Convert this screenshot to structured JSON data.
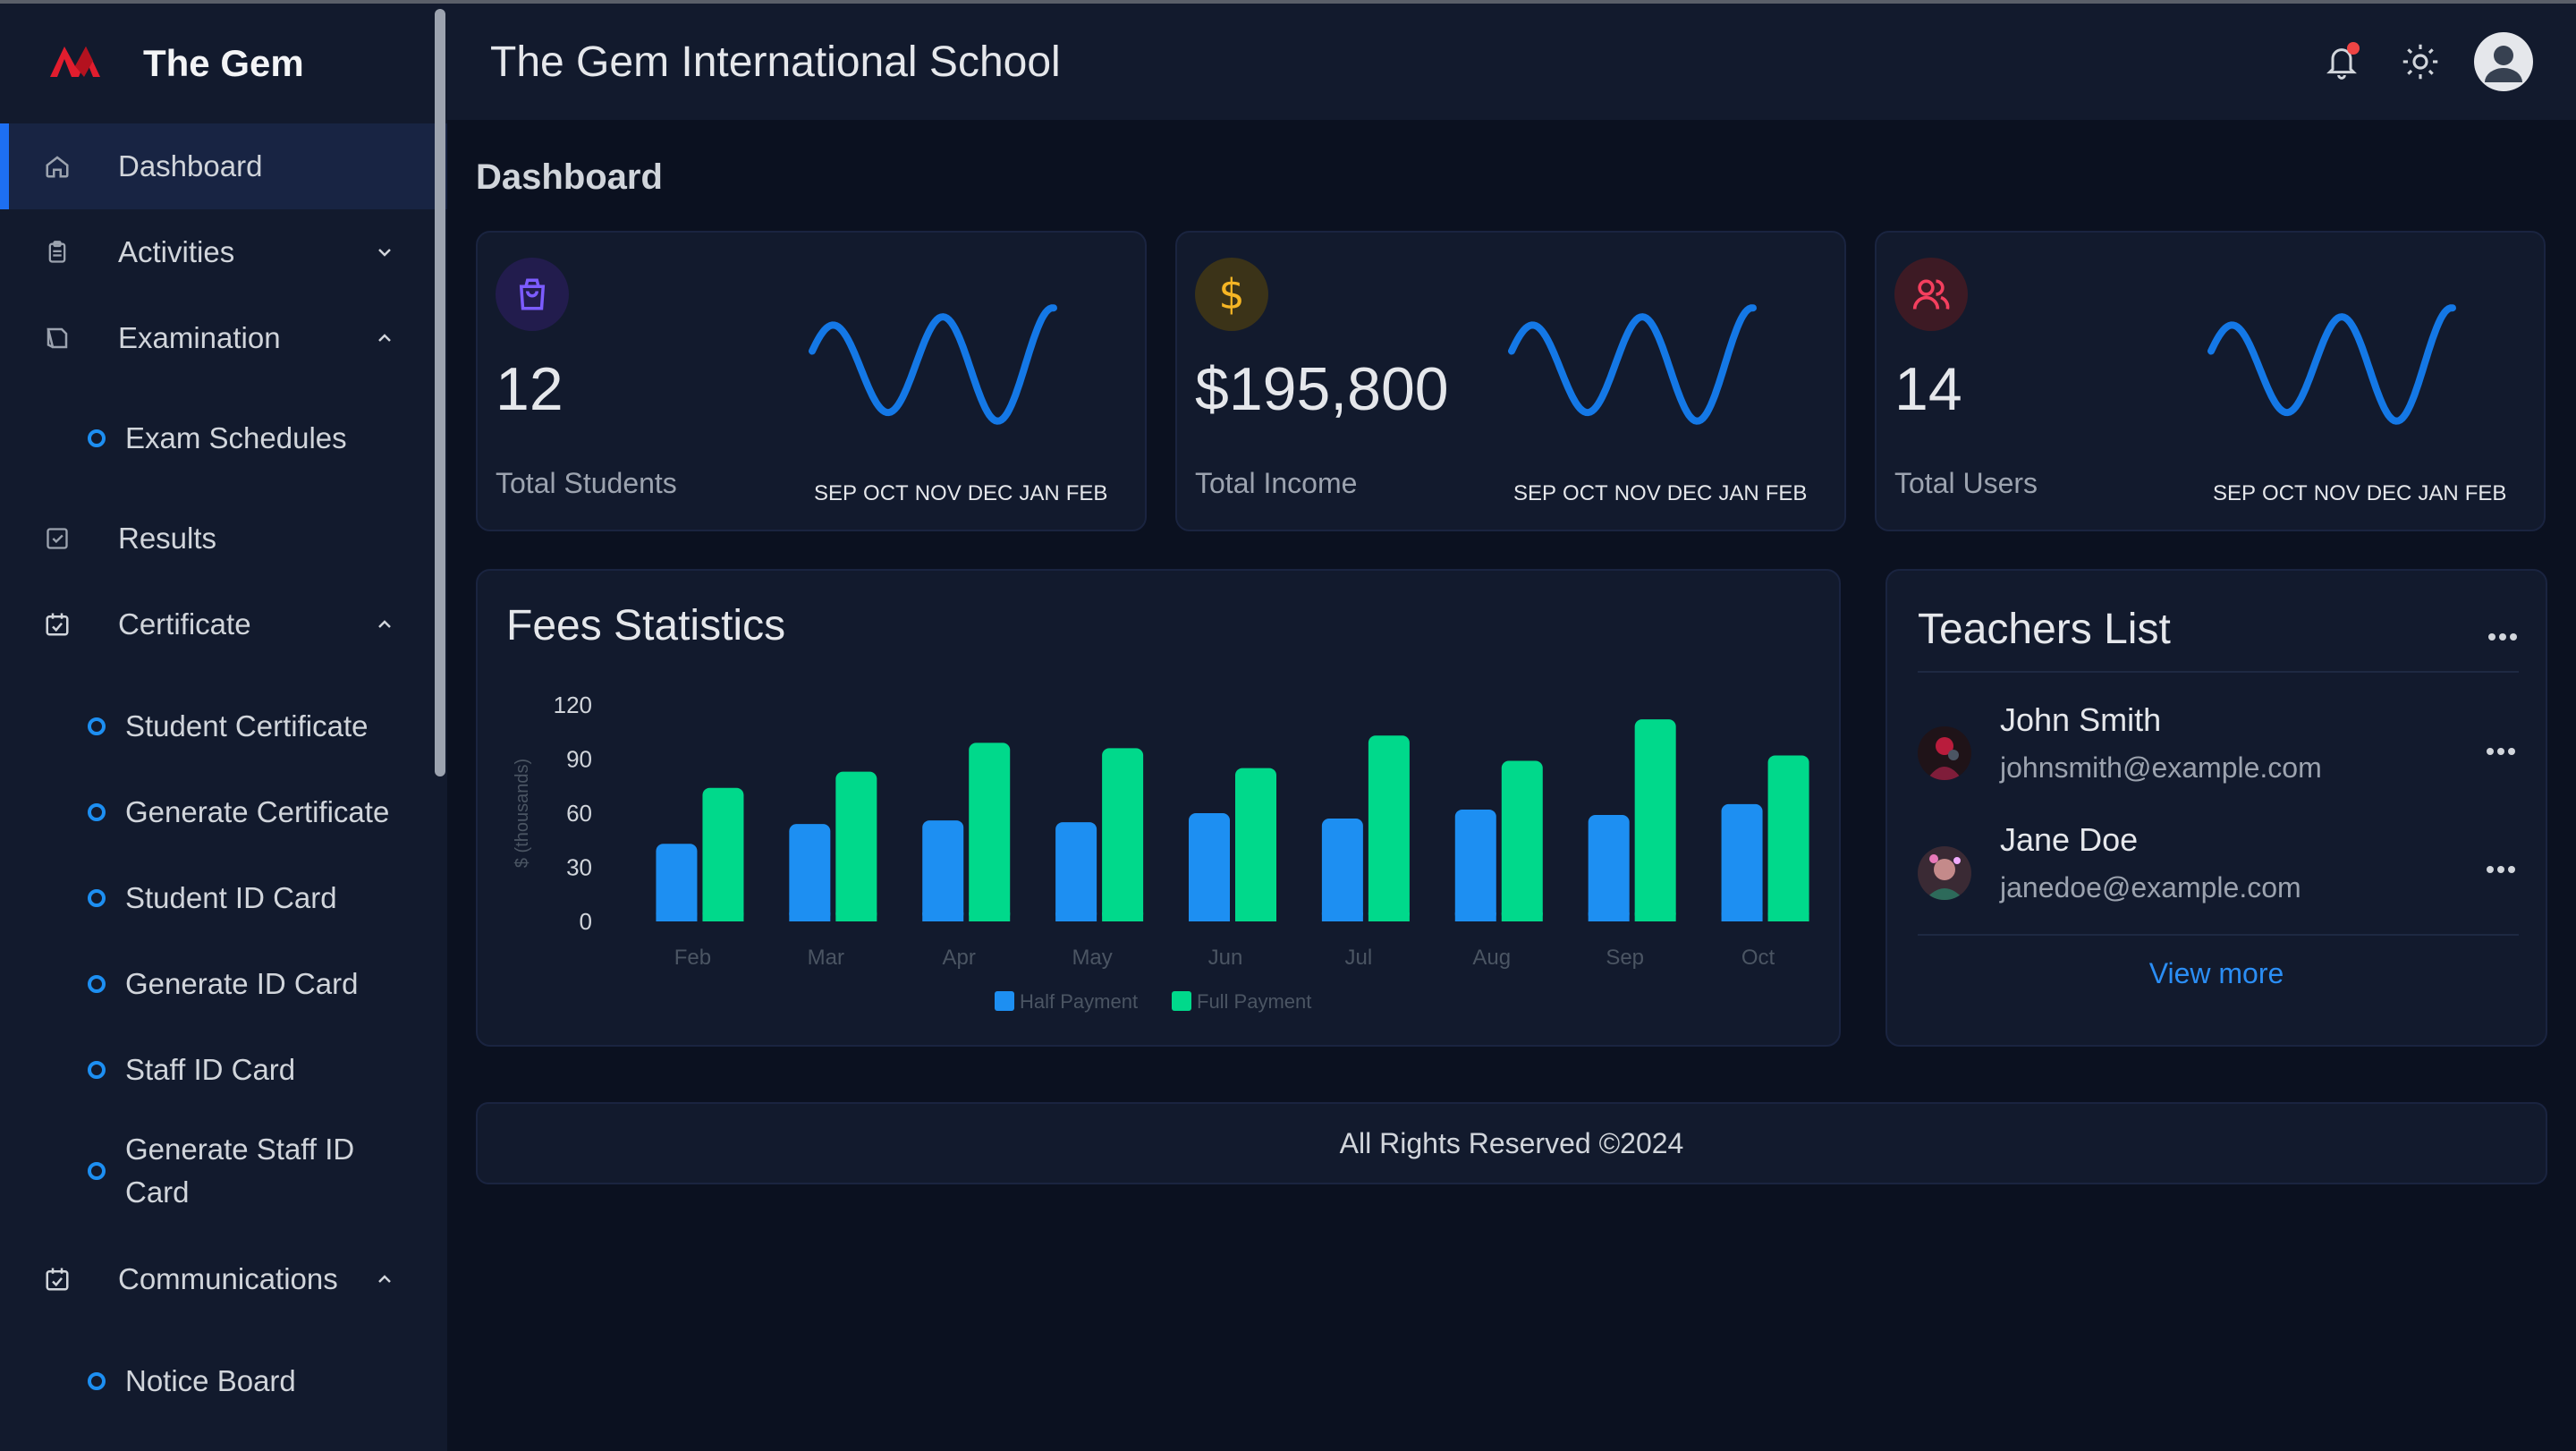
{
  "app": {
    "brand_name": "The Gem",
    "title": "The Gem International School"
  },
  "sidebar": {
    "items": [
      {
        "label": "Dashboard",
        "icon": "home-icon",
        "active": true
      },
      {
        "label": "Activities",
        "icon": "clipboard-icon",
        "expanded": false
      },
      {
        "label": "Examination",
        "icon": "book-icon",
        "expanded": true,
        "children": [
          "Exam Schedules"
        ]
      },
      {
        "label": "Results",
        "icon": "check-square-icon"
      },
      {
        "label": "Certificate",
        "icon": "calendar-check-icon",
        "expanded": true,
        "children": [
          "Student Certificate",
          "Generate Certificate",
          "Student ID Card",
          "Generate ID Card",
          "Staff ID Card",
          "Generate Staff ID Card"
        ]
      },
      {
        "label": "Communications",
        "icon": "calendar-check-icon",
        "expanded": true,
        "children": [
          "Notice Board"
        ]
      }
    ]
  },
  "page": {
    "title": "Dashboard"
  },
  "stats": [
    {
      "value": "12",
      "label": "Total Students",
      "icon": "shopping-bag-icon",
      "icon_color": "#6d4cff",
      "icon_bg": "#221c4d"
    },
    {
      "value": "$195,800",
      "label": "Total Income",
      "icon": "dollar-icon",
      "icon_color": "#f5b524",
      "icon_bg": "#3b3318"
    },
    {
      "value": "14",
      "label": "Total Users",
      "icon": "users-icon",
      "icon_color": "#f43f5e",
      "icon_bg": "#3d1a24"
    }
  ],
  "spark_months": [
    "SEP",
    "OCT",
    "NOV",
    "DEC",
    "JAN",
    "FEB"
  ],
  "fees": {
    "title": "Fees Statistics"
  },
  "chart_data": {
    "type": "bar",
    "categories": [
      "Feb",
      "Mar",
      "Apr",
      "May",
      "Jun",
      "Jul",
      "Aug",
      "Sep",
      "Oct"
    ],
    "series": [
      {
        "name": "Half Payment",
        "color": "#1d8ff2",
        "values": [
          43,
          54,
          56,
          55,
          60,
          57,
          62,
          59,
          65
        ]
      },
      {
        "name": "Full Payment",
        "color": "#00d98b",
        "values": [
          74,
          83,
          99,
          96,
          85,
          103,
          89,
          112,
          92
        ]
      }
    ],
    "ylabel": "$ (thousands)",
    "yticks": [
      0,
      30,
      60,
      90,
      120
    ],
    "ylim": [
      0,
      120
    ],
    "legend": "bottom"
  },
  "teachers": {
    "title": "Teachers List",
    "list": [
      {
        "name": "John Smith",
        "email": "johnsmith@example.com"
      },
      {
        "name": "Jane Doe",
        "email": "janedoe@example.com"
      }
    ],
    "view_more": "View more"
  },
  "footer": {
    "text": "All Rights Reserved ©2024"
  },
  "colors": {
    "accent": "#1d6ff2",
    "background": "#0b1120",
    "panel": "#121a2d"
  }
}
